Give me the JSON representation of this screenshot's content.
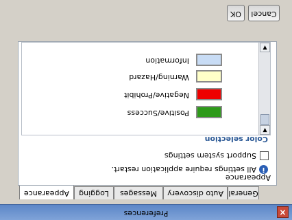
{
  "window": {
    "title": "Preferences"
  },
  "tabs": [
    "Appearance",
    "Logging",
    "Messages",
    "Auto discovery",
    "General"
  ],
  "active_tab": "Appearance",
  "appearance": {
    "section_label": "Appearance",
    "info_text": "All settings require application restart.",
    "system_settings_label": "Support system settings",
    "system_settings_checked": false,
    "color_selection_label": "Color selection",
    "colors": [
      {
        "label": "Positive/Success",
        "color": "#2e9a1a"
      },
      {
        "label": "Negative/Prohibit",
        "color": "#ee0000"
      },
      {
        "label": "Warning/Hazard",
        "color": "#ffffc8"
      },
      {
        "label": "Information",
        "color": "#c8dcf5"
      }
    ]
  },
  "buttons": {
    "ok": "OK",
    "cancel": "Cancel"
  },
  "icons": {
    "close": "close-icon",
    "info": "info-icon",
    "scroll_up": "arrow-up-icon",
    "scroll_down": "arrow-down-icon"
  }
}
